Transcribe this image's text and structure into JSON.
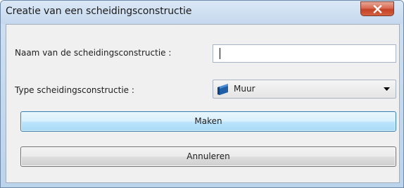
{
  "window": {
    "title": "Creatie van een scheidingsconstructie",
    "close_glyph": "X"
  },
  "form": {
    "name_label": "Naam van de scheidingsconstructie :",
    "name_value": "",
    "type_label": "Type scheidingsconstructie :",
    "type_value": "Muur",
    "type_icon": "wall-icon"
  },
  "buttons": {
    "make_label": "Maken",
    "cancel_label": "Annuleren"
  },
  "colors": {
    "accent_button": "#bee6fd",
    "close_button": "#c44327",
    "wall_icon": "#1f5fa8"
  }
}
